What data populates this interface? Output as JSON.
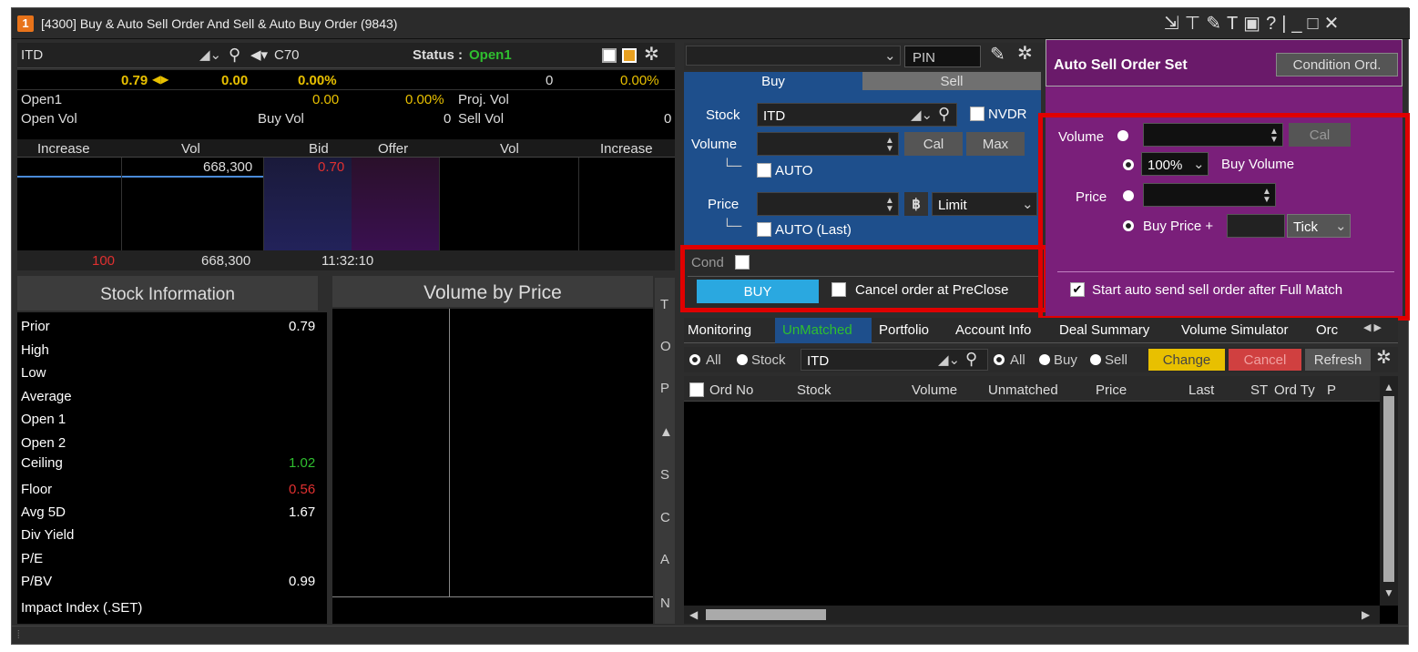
{
  "window": {
    "badge": "1",
    "title": "[4300] Buy & Auto Sell Order And Sell & Auto Buy Order (9843)"
  },
  "quote": {
    "symbol": "ITD",
    "broker": "C70",
    "status_label": "Status :",
    "status_value": "Open1",
    "last": "0.79",
    "change": "0.00",
    "change_pct": "0.00%",
    "vol_total": "0",
    "vol_pct": "0.00%",
    "open1_label": "Open1",
    "open1_value": "0.00",
    "open1_pct": "0.00%",
    "proj_vol_label": "Proj. Vol",
    "open_vol_label": "Open Vol",
    "buy_vol_label": "Buy Vol",
    "buy_vol_value": "0",
    "sell_vol_label": "Sell Vol",
    "sell_vol_value": "0",
    "depth_headers": [
      "Increase",
      "Vol",
      "Bid",
      "Offer",
      "Vol",
      "Increase"
    ],
    "bid_vol": "668,300",
    "bid_price": "0.70",
    "footer_left": "100",
    "footer_vol": "668,300",
    "footer_time": "11:32:10"
  },
  "stock_info": {
    "title": "Stock Information",
    "rows": [
      {
        "label": "Prior",
        "value": "0.79"
      },
      {
        "label": "High",
        "value": ""
      },
      {
        "label": "Low",
        "value": ""
      },
      {
        "label": "Average",
        "value": ""
      },
      {
        "label": "Open 1",
        "value": ""
      },
      {
        "label": "Open 2",
        "value": ""
      },
      {
        "label": "Ceiling",
        "value": "1.02"
      },
      {
        "label": "Floor",
        "value": "0.56"
      },
      {
        "label": "Avg 5D",
        "value": "1.67"
      },
      {
        "label": "Div Yield",
        "value": ""
      },
      {
        "label": "P/E",
        "value": ""
      },
      {
        "label": "P/BV",
        "value": "0.99"
      },
      {
        "label": "Impact Index (.SET)",
        "value": ""
      }
    ]
  },
  "vbp": {
    "title": "Volume by Price",
    "side_tabs": [
      "T",
      "O",
      "P",
      "▲",
      "S",
      "C",
      "A",
      "N"
    ]
  },
  "order": {
    "pin_placeholder": "PIN",
    "tab_buy": "Buy",
    "tab_sell": "Sell",
    "stock_label": "Stock",
    "stock_value": "ITD",
    "nvdr": "NVDR",
    "volume_label": "Volume",
    "cal": "Cal",
    "max": "Max",
    "auto": "AUTO",
    "price_label": "Price",
    "price_type": "Limit",
    "auto_last": "AUTO (Last)",
    "cond": "Cond",
    "buy_button": "BUY",
    "cancel_preclose": "Cancel order at PreClose"
  },
  "auto_sell": {
    "title": "Auto Sell Order Set",
    "condition_btn": "Condition Ord.",
    "volume_label": "Volume",
    "cal": "Cal",
    "pct_value": "100%",
    "buy_volume": "Buy Volume",
    "price_label": "Price",
    "buy_price_plus": "Buy Price +",
    "tick": "Tick",
    "start_auto": "Start auto send sell order after Full Match"
  },
  "bottom": {
    "tabs": [
      "Monitoring",
      "UnMatched",
      "Portfolio",
      "Account Info",
      "Deal Summary",
      "Volume Simulator",
      "Orc"
    ],
    "filter": {
      "all": "All",
      "stock": "Stock",
      "stock_value": "ITD",
      "all2": "All",
      "buy": "Buy",
      "sell": "Sell",
      "change": "Change",
      "cancel": "Cancel",
      "refresh": "Refresh"
    },
    "columns": [
      "Ord No",
      "Stock",
      "Volume",
      "Unmatched",
      "Price",
      "Last",
      "ST",
      "Ord Ty",
      "P"
    ]
  },
  "colors": {
    "green": "#2fbf2f",
    "red": "#e03030",
    "yellow": "#e8c000",
    "purple": "#7a1f7a",
    "blue": "#1e4f8c"
  }
}
